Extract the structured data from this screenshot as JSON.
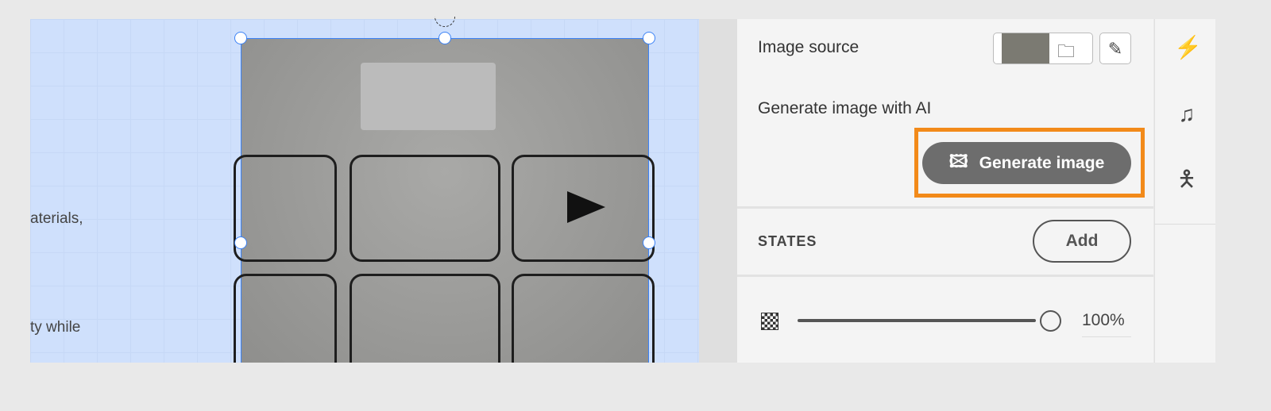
{
  "canvas": {
    "text_lines": [
      "aterials,",
      "ty while"
    ]
  },
  "panel": {
    "image_source_label": "Image source",
    "generate_ai_label": "Generate image with AI",
    "generate_button": "Generate image",
    "states_label": "STATES",
    "add_button": "Add",
    "opacity_value": "100%",
    "opacity_percent": 100
  },
  "rail": {
    "icons": [
      "interactions-icon",
      "audio-icon",
      "accessibility-icon"
    ]
  },
  "colors": {
    "highlight": "#f28a1a",
    "selection": "#3b82f6",
    "button": "#6d6d6d"
  }
}
